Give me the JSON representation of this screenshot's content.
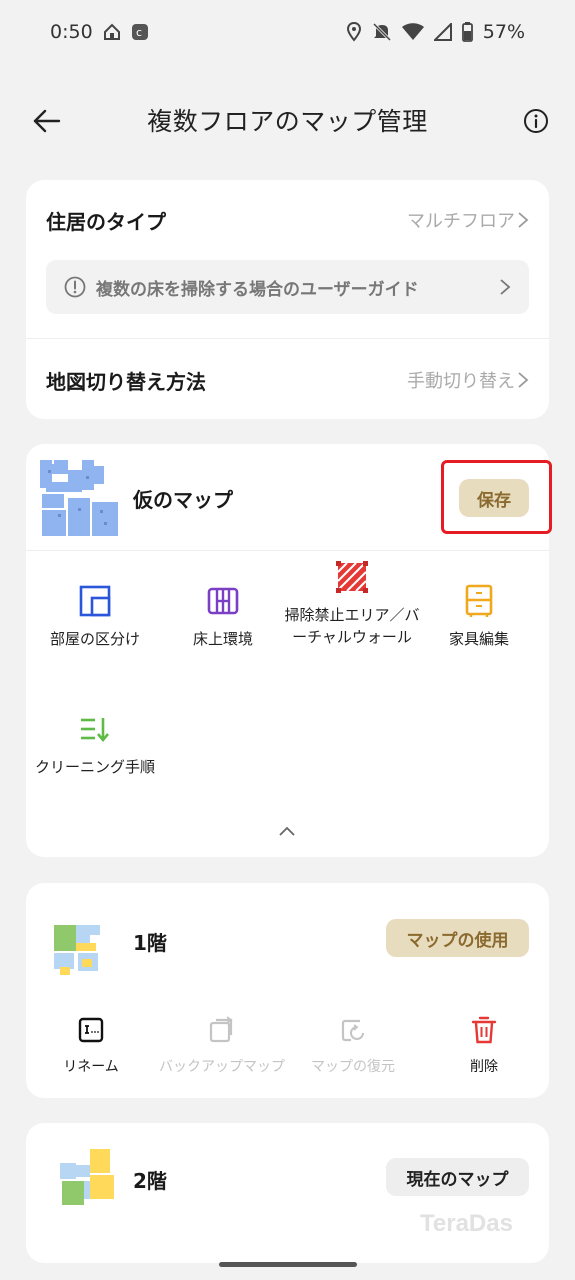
{
  "status_bar": {
    "time": "0:50",
    "battery": "57%"
  },
  "header": {
    "title": "複数フロアのマップ管理"
  },
  "settings": {
    "residence_label": "住居のタイプ",
    "residence_value": "マルチフロア",
    "guide_text": "複数の床を掃除する場合のユーザーガイド",
    "switch_label": "地図切り替え方法",
    "switch_value": "手動切り替え"
  },
  "temp_map": {
    "name": "仮のマップ",
    "save_label": "保存",
    "tools": [
      {
        "label": "部屋の区分け",
        "icon": "room-divide-icon"
      },
      {
        "label": "床上環境",
        "icon": "floor-environment-icon"
      },
      {
        "label": "掃除禁止エリア／バーチャルウォール",
        "icon": "no-go-zone-icon"
      },
      {
        "label": "家具編集",
        "icon": "furniture-edit-icon"
      },
      {
        "label": "クリーニング手順",
        "icon": "cleaning-sequence-icon"
      }
    ]
  },
  "floor1": {
    "name": "1階",
    "use_map_label": "マップの使用",
    "actions": [
      {
        "label": "リネーム",
        "icon": "rename-icon",
        "enabled": true
      },
      {
        "label": "バックアップマップ",
        "icon": "backup-map-icon",
        "enabled": false
      },
      {
        "label": "マップの復元",
        "icon": "restore-map-icon",
        "enabled": false
      },
      {
        "label": "削除",
        "icon": "delete-icon",
        "enabled": true
      }
    ]
  },
  "floor2": {
    "name": "2階",
    "current_map_label": "現在のマップ"
  },
  "watermark": "TeraDas",
  "colors": {
    "accent_gold": "#e8dcbf",
    "accent_gold_text": "#8a6a2e",
    "highlight_red": "#e51c23",
    "delete_red": "#e53935"
  }
}
